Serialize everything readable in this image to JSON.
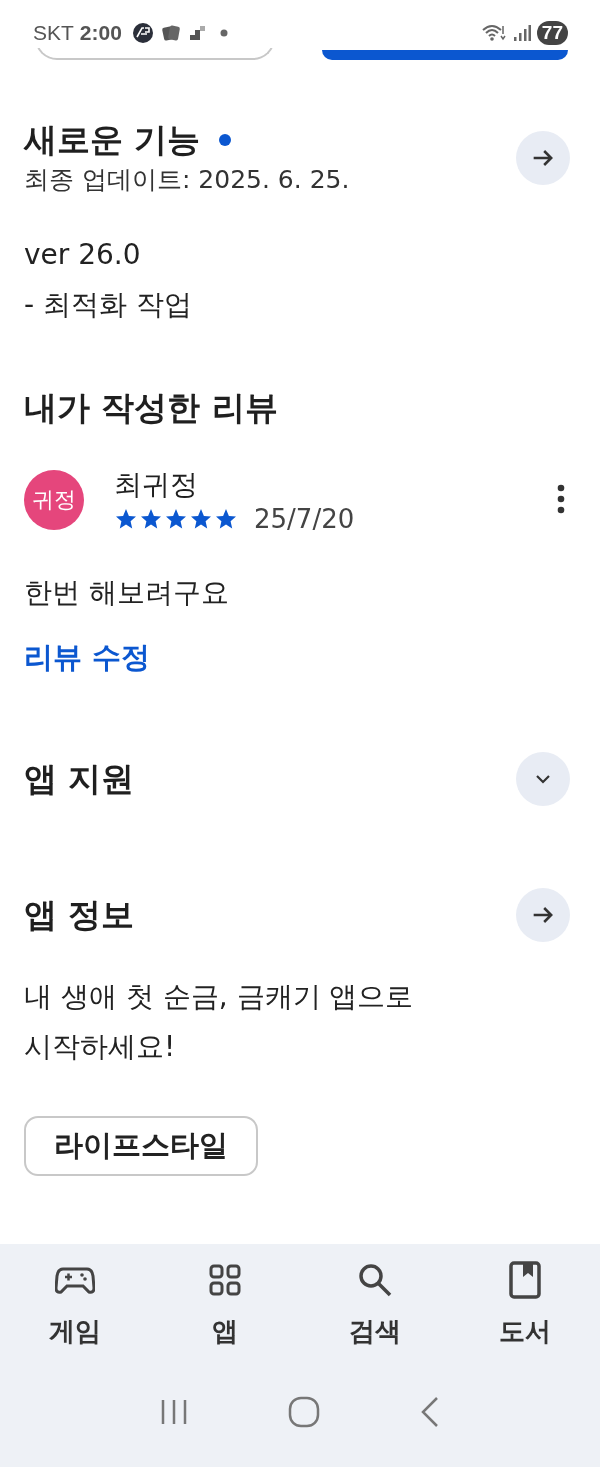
{
  "status_bar": {
    "carrier": "SKT",
    "time": "2:00",
    "battery": "77"
  },
  "whats_new": {
    "title": "새로운 기능",
    "new_dot": true,
    "updated": "최종 업데이트: 2025. 6. 25.",
    "version": "ver 26.0",
    "notes": "- 최적화 작업"
  },
  "my_review": {
    "title": "내가 작성한 리뷰",
    "avatar_text": "귀정",
    "author": "최귀정",
    "stars": 5,
    "date": "25/7/20",
    "text": "한번 해보려구요",
    "edit_link": "리뷰 수정"
  },
  "app_support": {
    "title": "앱 지원",
    "expanded": false
  },
  "app_info": {
    "title": "앱 정보",
    "description": "내 생애 첫 순금, 금캐기 앱으로 시작하세요!",
    "category": "라이프스타일"
  },
  "bottom_nav": [
    {
      "kind": "games",
      "label": "게임",
      "selected": false
    },
    {
      "kind": "apps",
      "label": "앱",
      "selected": false
    },
    {
      "kind": "search",
      "label": "검색",
      "selected": false
    },
    {
      "kind": "books",
      "label": "도서",
      "selected": false
    }
  ]
}
